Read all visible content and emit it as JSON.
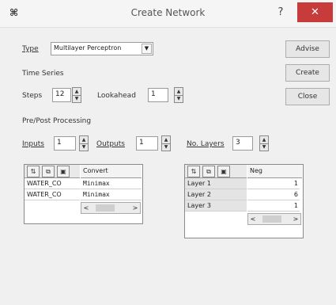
{
  "window": {
    "title": "Create Network",
    "help_glyph": "?",
    "close_glyph": "✕"
  },
  "type_row": {
    "label": "Type",
    "value": "Multilayer Perceptron"
  },
  "time_series": {
    "label": "Time Series",
    "steps_label": "Steps",
    "steps_value": "12",
    "lookahead_label": "Lookahead",
    "lookahead_value": "1"
  },
  "prepost": {
    "label": "Pre/Post Processing",
    "inputs_label": "Inputs",
    "inputs_value": "1",
    "outputs_label": "Outputs",
    "outputs_value": "1",
    "layers_label": "No. Layers",
    "layers_value": "3"
  },
  "buttons": {
    "advise": "Advise",
    "create": "Create",
    "close": "Close"
  },
  "io_table": {
    "column_header": "Convert",
    "rows": [
      {
        "name": "WATER_CO",
        "value": "Minimax"
      },
      {
        "name": "WATER_CO",
        "value": "Minimax"
      }
    ]
  },
  "layers_table": {
    "column_header": "Neg",
    "rows": [
      {
        "name": "Layer 1",
        "value": "1"
      },
      {
        "name": "Layer 2",
        "value": "6"
      },
      {
        "name": "Layer 3",
        "value": "1"
      }
    ]
  },
  "scroll": {
    "left": "<",
    "right": ">"
  },
  "icons": {
    "app": "app-network-icon",
    "toolbar": [
      "sort-icon",
      "copy-icon",
      "save-icon"
    ]
  }
}
